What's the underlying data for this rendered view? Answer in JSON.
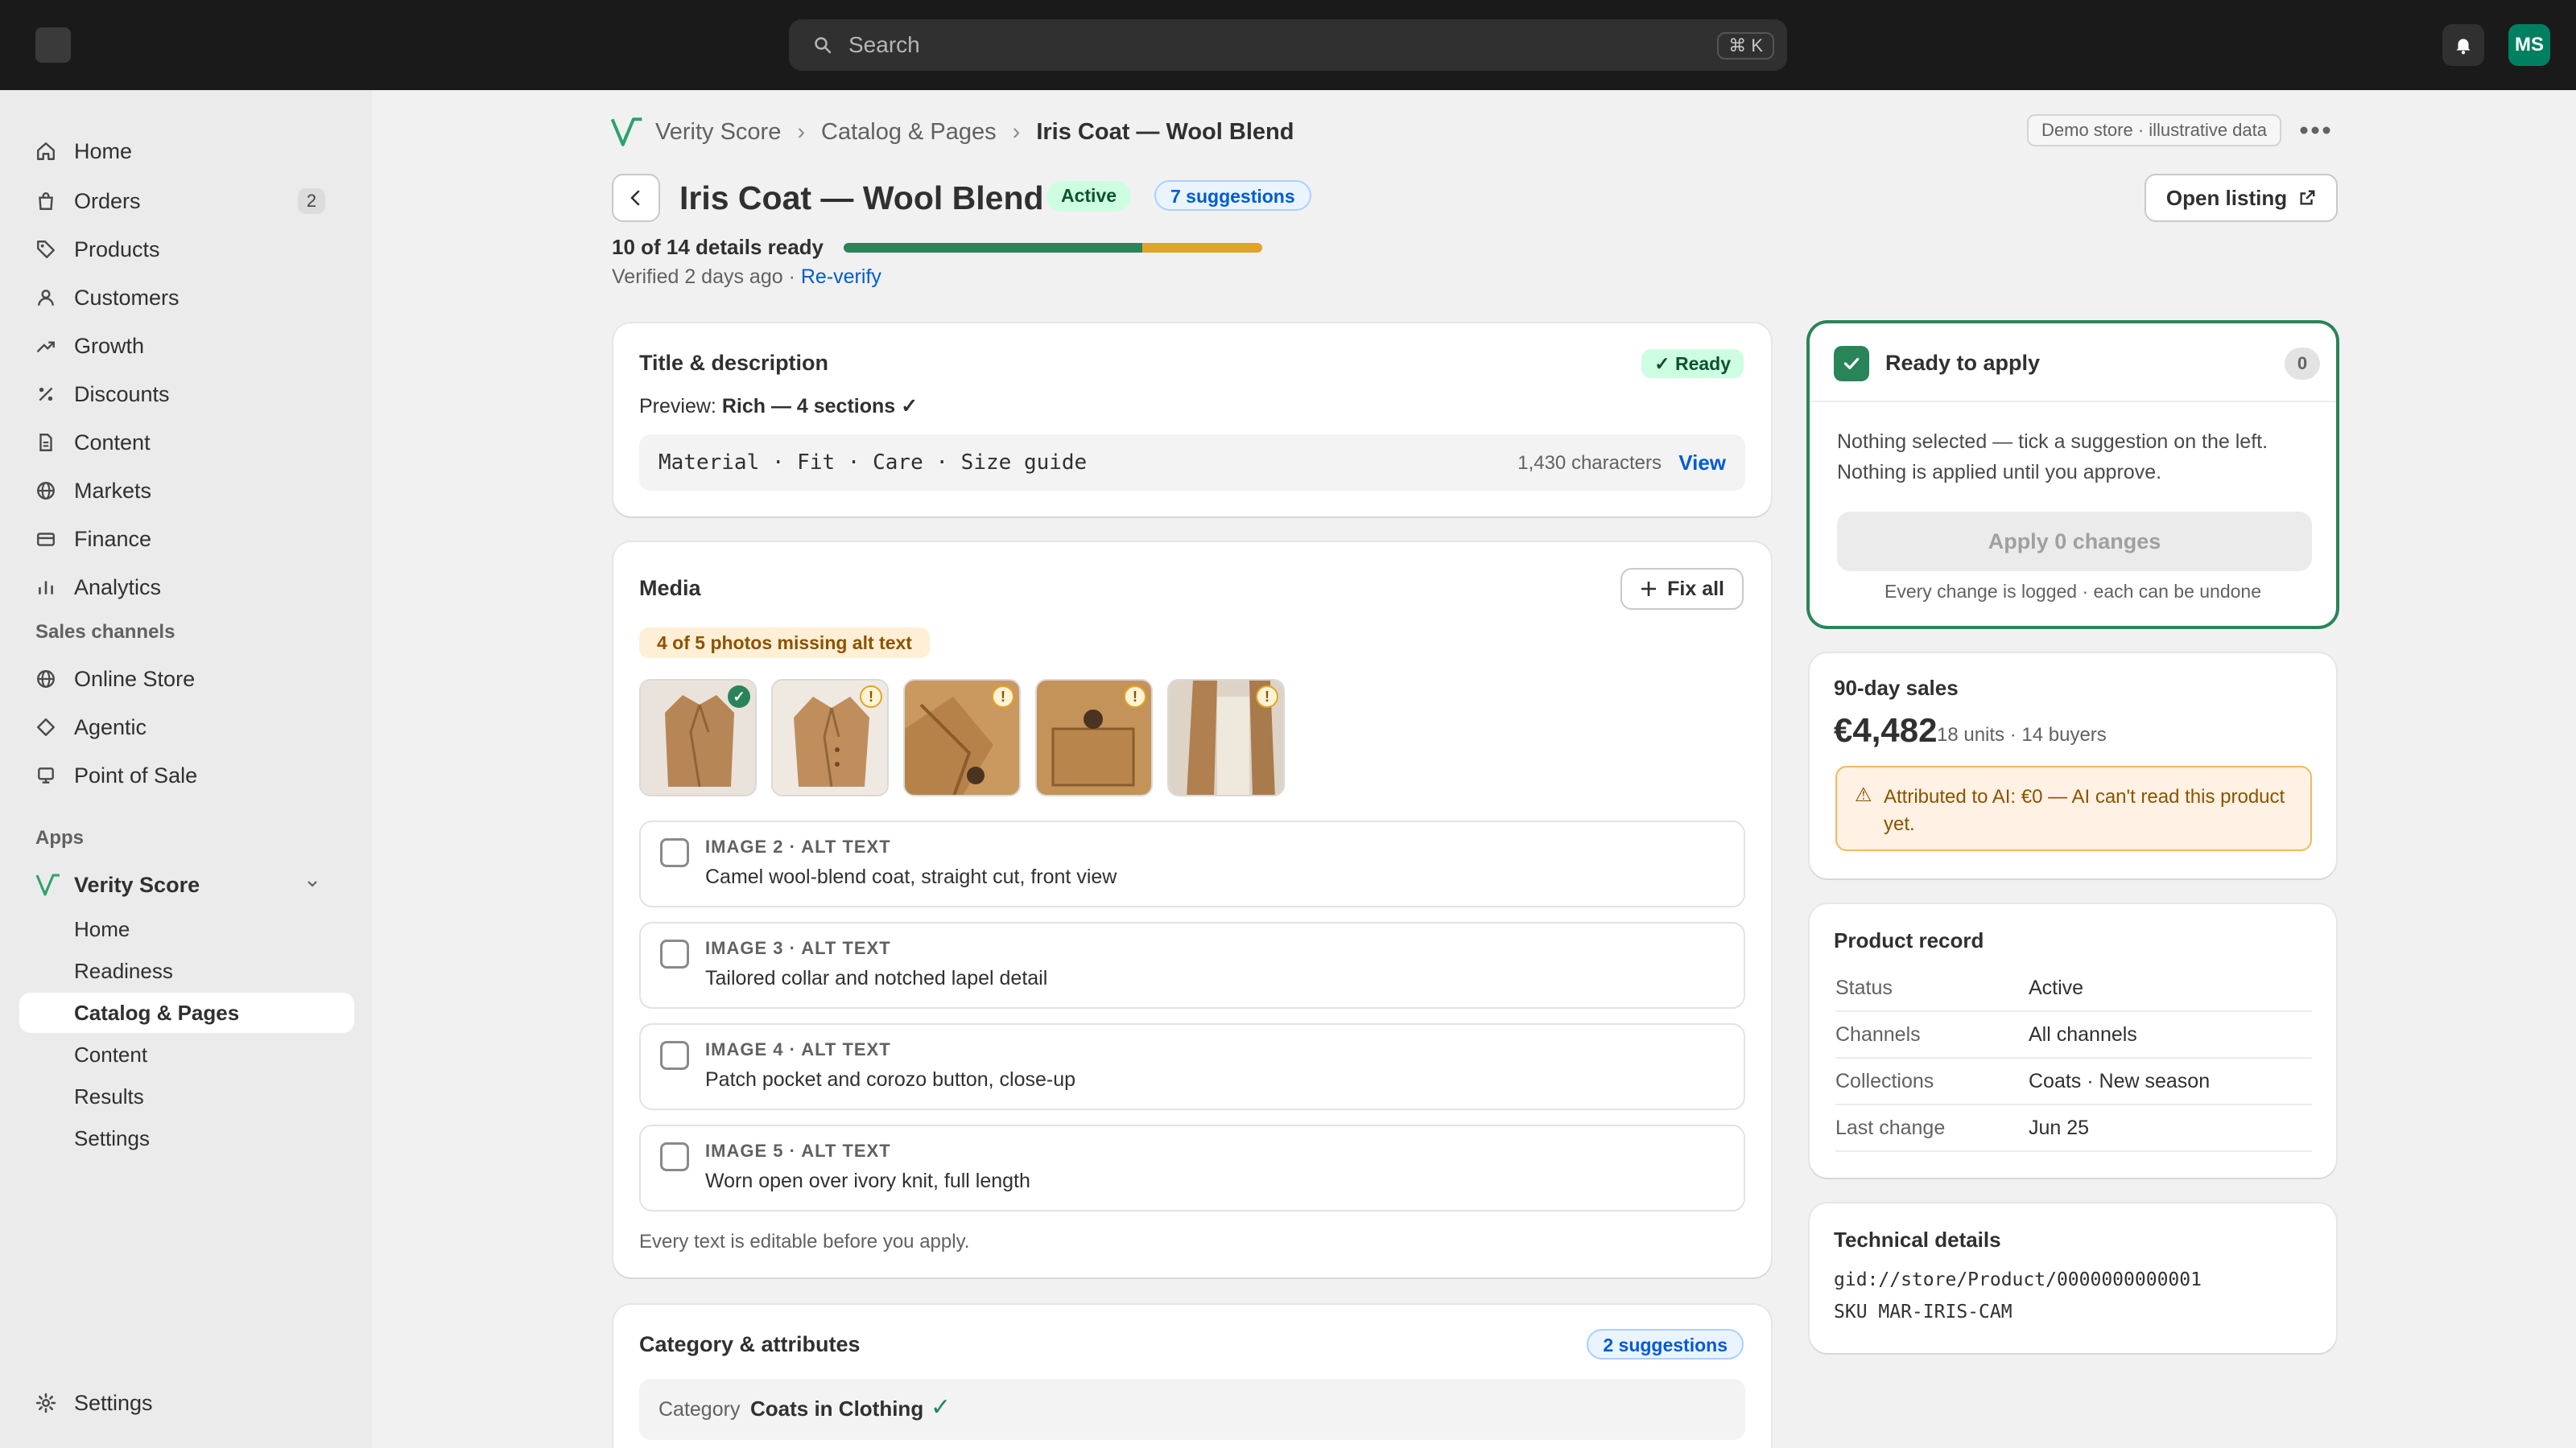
{
  "topbar": {
    "search_placeholder": "Search",
    "search_shortcut": "⌘ K",
    "avatar_initials": "MS",
    "accent_color": "#008060"
  },
  "sidebar": {
    "items": [
      {
        "label": "Home",
        "icon": "home-icon"
      },
      {
        "label": "Orders",
        "icon": "bag-icon",
        "badge": "2"
      },
      {
        "label": "Products",
        "icon": "tag-icon"
      },
      {
        "label": "Customers",
        "icon": "person-icon"
      },
      {
        "label": "Growth",
        "icon": "trend-icon"
      },
      {
        "label": "Discounts",
        "icon": "percent-icon"
      },
      {
        "label": "Content",
        "icon": "document-icon"
      },
      {
        "label": "Markets",
        "icon": "globe-icon"
      },
      {
        "label": "Finance",
        "icon": "card-icon"
      },
      {
        "label": "Analytics",
        "icon": "bar-chart-icon"
      }
    ],
    "sales_channels_heading": "Sales channels",
    "sales_channels": [
      {
        "label": "Online Store",
        "icon": "globe-icon"
      },
      {
        "label": "Agentic",
        "icon": "diamond-icon"
      },
      {
        "label": "Point of Sale",
        "icon": "pos-icon"
      }
    ],
    "apps_heading": "Apps",
    "app_name": "Verity Score",
    "app_subitems": [
      "Home",
      "Readiness",
      "Catalog & Pages",
      "Content",
      "Results",
      "Settings"
    ],
    "active_subitem": "Catalog & Pages",
    "settings_label": "Settings"
  },
  "breadcrumb": {
    "app": "Verity Score",
    "section": "Catalog & Pages",
    "current": "Iris Coat — Wool Blend"
  },
  "demo_tag": "Demo store · illustrative data",
  "page": {
    "title": "Iris Coat — Wool Blend",
    "status": "Active",
    "suggestions": "7 suggestions",
    "open_listing": "Open listing",
    "ready_text": "10 of 14 details ready",
    "ready_count": 10,
    "total_details": 14,
    "pending_details": 4,
    "verified_text": "Verified 2 days ago · ",
    "reverify": "Re-verify"
  },
  "title_card": {
    "title": "Title & description",
    "status": "✓ Ready",
    "preview_label": "Preview: ",
    "preview_value": "Rich — 4 sections ✓",
    "sections": "Material · Fit · Care · Size guide",
    "characters": "1,430 characters",
    "view": "View"
  },
  "media_card": {
    "title": "Media",
    "fix_all": "Fix all",
    "missing_pill": "4 of 5 photos missing alt text",
    "thumbs": [
      {
        "status": "✓",
        "ok": true
      },
      {
        "status": "!",
        "ok": false
      },
      {
        "status": "!",
        "ok": false
      },
      {
        "status": "!",
        "ok": false
      },
      {
        "status": "!",
        "ok": false
      }
    ],
    "alt_rows": [
      {
        "label": "IMAGE 2 · ALT TEXT",
        "value": "Camel wool-blend coat, straight cut, front view"
      },
      {
        "label": "IMAGE 3 · ALT TEXT",
        "value": "Tailored collar and notched lapel detail"
      },
      {
        "label": "IMAGE 4 · ALT TEXT",
        "value": "Patch pocket and corozo button, close-up"
      },
      {
        "label": "IMAGE 5 · ALT TEXT",
        "value": "Worn open over ivory knit, full length"
      }
    ],
    "hint": "Every text is editable before you apply."
  },
  "category_card": {
    "title": "Category & attributes",
    "suggestions": "2 suggestions",
    "category_label": "Category",
    "category_value": "Coats in Clothing",
    "check": "✓"
  },
  "apply_card": {
    "title": "Ready to apply",
    "count": "0",
    "line1": "Nothing selected — tick a suggestion on the left.",
    "line2": "Nothing is applied until you approve.",
    "button": "Apply 0 changes",
    "footnote": "Every change is logged · each can be undone"
  },
  "sales_card": {
    "title": "90-day sales",
    "amount": "€4,482",
    "meta": "18 units · 14 buyers",
    "warning": "Attributed to AI: €0 — AI can't read this product yet."
  },
  "record_card": {
    "title": "Product record",
    "rows": [
      {
        "key": "Status",
        "value": "Active"
      },
      {
        "key": "Channels",
        "value": "All channels"
      },
      {
        "key": "Collections",
        "value": "Coats · New season"
      },
      {
        "key": "Last change",
        "value": "Jun 25"
      }
    ]
  },
  "tech_card": {
    "title": "Technical details",
    "gid": "gid://store/Product/0000000000001",
    "sku": "SKU MAR-IRIS-CAM"
  }
}
